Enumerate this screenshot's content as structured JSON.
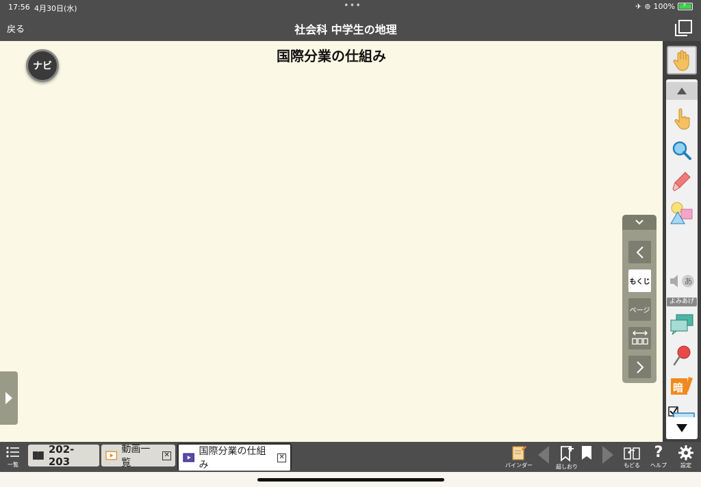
{
  "status_bar": {
    "time": "17:56",
    "date": "4月30日(水)",
    "battery": "100%"
  },
  "header": {
    "back_label": "戻る",
    "title": "社会科 中学生の地理"
  },
  "content": {
    "heading": "国際分業の仕組み",
    "navi_label": "ナビ"
  },
  "page_nav": {
    "mokuji_label": "もくじ",
    "page_label": "ページ"
  },
  "toolbar": {
    "yomiage_label": "よみあげ"
  },
  "bottom_bar": {
    "list_label": "一覧",
    "tabs": [
      {
        "label": "202-203"
      },
      {
        "label": "動画一覧"
      },
      {
        "label": "国際分業の仕組み"
      }
    ],
    "binder_label": "バインダー",
    "bookmark_add_label": "超しおり",
    "back_label": "もどる",
    "help_label": "ヘルプ",
    "settings_label": "設定"
  },
  "colors": {
    "bar": "#4d4d4d",
    "canvas": "#fbf9e6",
    "battery": "#3bd44a"
  }
}
